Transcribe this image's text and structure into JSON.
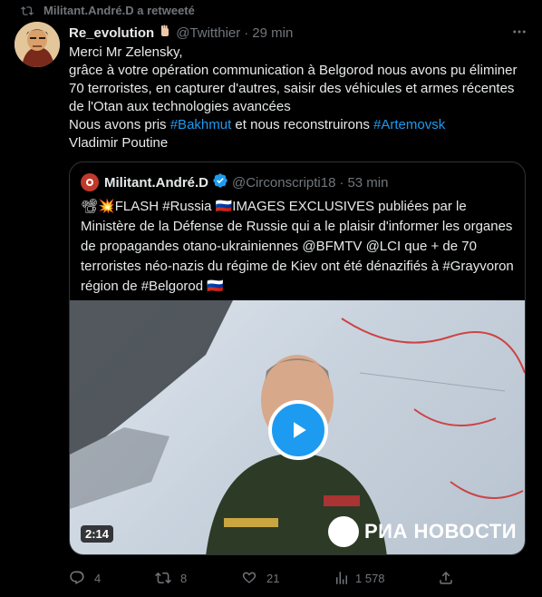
{
  "retweet": {
    "label": "Militant.André.D a retweeté"
  },
  "tweet": {
    "author_name": "Re_evolution",
    "author_handle": "@Twitthier",
    "time": "29 min",
    "text": {
      "line1": "Merci Mr Zelensky,",
      "line2": "grâce à votre opération communication à Belgorod nous avons pu éliminer 70 terroristes, en capturer d'autres, saisir des véhicules et armes récentes de l'Otan aux technologies avancées",
      "line3_prefix": "Nous avons pris ",
      "hashtag1": "#Bakhmut",
      "line3_mid": " et nous reconstruirons ",
      "hashtag2": "#Artemovsk",
      "line4": "Vladimir Poutine"
    }
  },
  "quote": {
    "author_name": "Militant.André.D",
    "author_handle": "@Circonscripti18",
    "time": "53 min",
    "text": "📽💥FLASH #Russia 🇷🇺IMAGES EXCLUSIVES publiées par le Ministère de la Défense de Russie qui a le plaisir d'informer les organes de propagandes otano-ukrainiennes @BFMTV @LCI que + de 70 terroristes néo-nazis du régime de Kiev ont été dénazifiés à #Grayvoron région de #Belgorod 🇷🇺",
    "video": {
      "duration": "2:14",
      "watermark": "РИА НОВОСТИ"
    }
  },
  "actions": {
    "replies": "4",
    "retweets": "8",
    "likes": "21",
    "views": "1 578"
  },
  "colors": {
    "accent": "#1d9bf0",
    "muted": "#71767b",
    "bg": "#000000"
  }
}
